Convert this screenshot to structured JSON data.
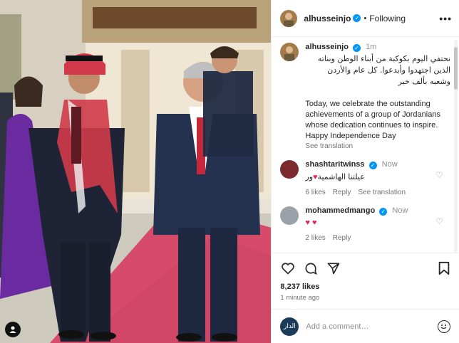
{
  "header": {
    "username": "alhusseinjo",
    "separator": "•",
    "follow_status": "Following",
    "more": "•••"
  },
  "caption": {
    "username": "alhusseinjo",
    "time": "1m",
    "arabic_line1": "نحتفي اليوم بكوكبة من أبناء الوطن وبناته",
    "arabic_line2": "الذين اجتهدوا وأبدعوا. كل عام والأردن",
    "arabic_line3": "وشعبه بألف خير",
    "english": "Today, we celebrate the outstanding achievements of a group of Jordanians whose dedication continues to inspire. Happy Independence Day",
    "see_translation": "See translation"
  },
  "comments": [
    {
      "username": "shashtaritwinss",
      "time": "Now",
      "text": "عيلتنا الهاشمية",
      "emoji": "♥",
      "suffix": "ور",
      "likes": "6 likes",
      "reply": "Reply",
      "see_translation": "See translation"
    },
    {
      "username": "mohammedmango",
      "time": "Now",
      "text": "♥ ♥",
      "likes": "2 likes",
      "reply": "Reply"
    }
  ],
  "stats": {
    "likes": "8,237 likes",
    "time_ago": "1 minute ago"
  },
  "composer": {
    "avatar_text": "الدار",
    "placeholder": "Add a comment…"
  },
  "colors": {
    "verified": "#0095f6",
    "heart": "#e0245e",
    "carpet": "#d64a6a"
  }
}
